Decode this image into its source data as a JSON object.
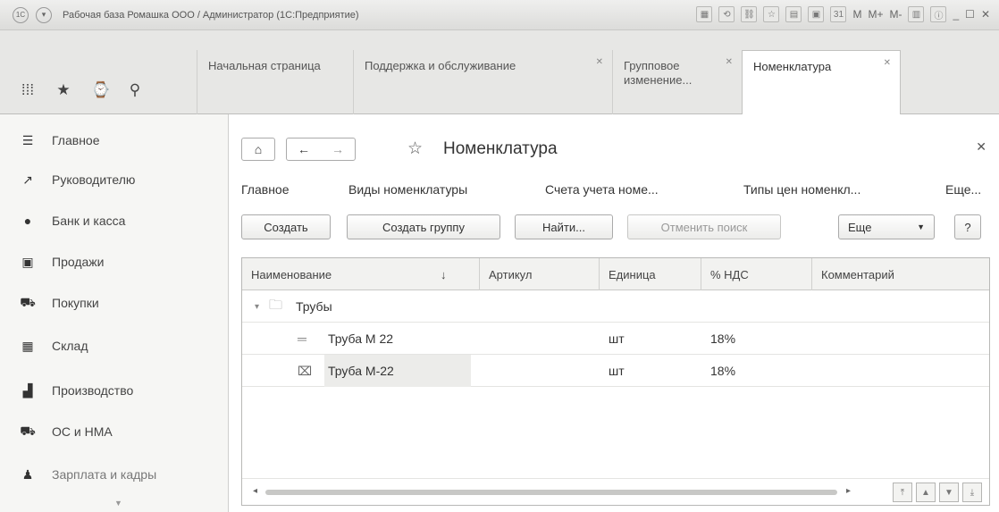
{
  "window": {
    "logo": "1С",
    "title": "Рабочая база Ромашка ООО / Администратор  (1С:Предприятие)",
    "tools": [
      "M",
      "M+",
      "M-"
    ]
  },
  "tabs": [
    {
      "label": "Начальная страница",
      "closable": false
    },
    {
      "label": "Поддержка и обслуживание",
      "closable": true
    },
    {
      "label": "Групповое изменение...",
      "closable": true
    },
    {
      "label": "Номенклатура",
      "closable": true,
      "active": true
    }
  ],
  "sidebar": {
    "items": [
      {
        "label": "Главное",
        "icon": "menu-lines-icon"
      },
      {
        "label": "Руководителю",
        "icon": "trend-icon"
      },
      {
        "label": "Банк и касса",
        "icon": "coin-icon"
      },
      {
        "label": "Продажи",
        "icon": "shop-bag-icon"
      },
      {
        "label": "Покупки",
        "icon": "cart-icon"
      },
      {
        "label": "Склад",
        "icon": "warehouse-icon"
      },
      {
        "label": "Производство",
        "icon": "factory-icon"
      },
      {
        "label": "ОС и НМА",
        "icon": "truck-icon"
      },
      {
        "label": "Зарплата и кадры",
        "icon": "person-icon"
      }
    ]
  },
  "form": {
    "title": "Номенклатура",
    "links": [
      "Главное",
      "Виды номенклатуры",
      "Счета учета номе...",
      "Типы цен номенкл...",
      "Еще..."
    ],
    "toolbar": {
      "create": "Создать",
      "create_group": "Создать группу",
      "find": "Найти...",
      "cancel_search": "Отменить поиск",
      "more": "Еще",
      "help": "?"
    }
  },
  "table": {
    "columns": [
      "Наименование",
      "Артикул",
      "Единица",
      "% НДС",
      "Комментарий"
    ],
    "sort_indicator": "↓",
    "group": "Трубы",
    "rows": [
      {
        "name": "Труба М 22",
        "article": "",
        "unit": "шт",
        "vat": "18%",
        "comment": "",
        "marked": false
      },
      {
        "name": "Труба М-22",
        "article": "",
        "unit": "шт",
        "vat": "18%",
        "comment": "",
        "marked": true
      }
    ]
  },
  "colors": {
    "accent": "#333333",
    "background": "#f4f4f2"
  }
}
